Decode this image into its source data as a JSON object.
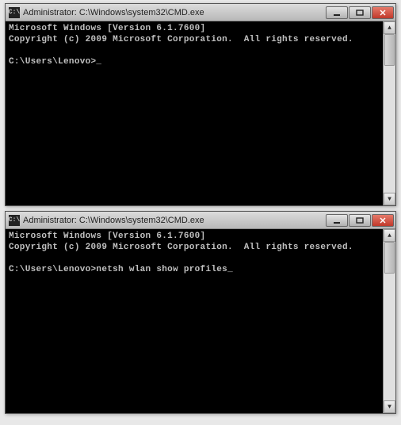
{
  "windows": [
    {
      "title": "Administrator: C:\\Windows\\system32\\CMD.exe",
      "lines": {
        "version": "Microsoft Windows [Version 6.1.7600]",
        "copyright": "Copyright (c) 2009 Microsoft Corporation.  All rights reserved.",
        "blank": "",
        "prompt": "C:\\Users\\Lenovo>"
      },
      "typed_command": ""
    },
    {
      "title": "Administrator: C:\\Windows\\system32\\CMD.exe",
      "lines": {
        "version": "Microsoft Windows [Version 6.1.7600]",
        "copyright": "Copyright (c) 2009 Microsoft Corporation.  All rights reserved.",
        "blank": "",
        "prompt": "C:\\Users\\Lenovo>"
      },
      "typed_command": "netsh wlan show profiles"
    }
  ],
  "icon_label": "C:\\"
}
